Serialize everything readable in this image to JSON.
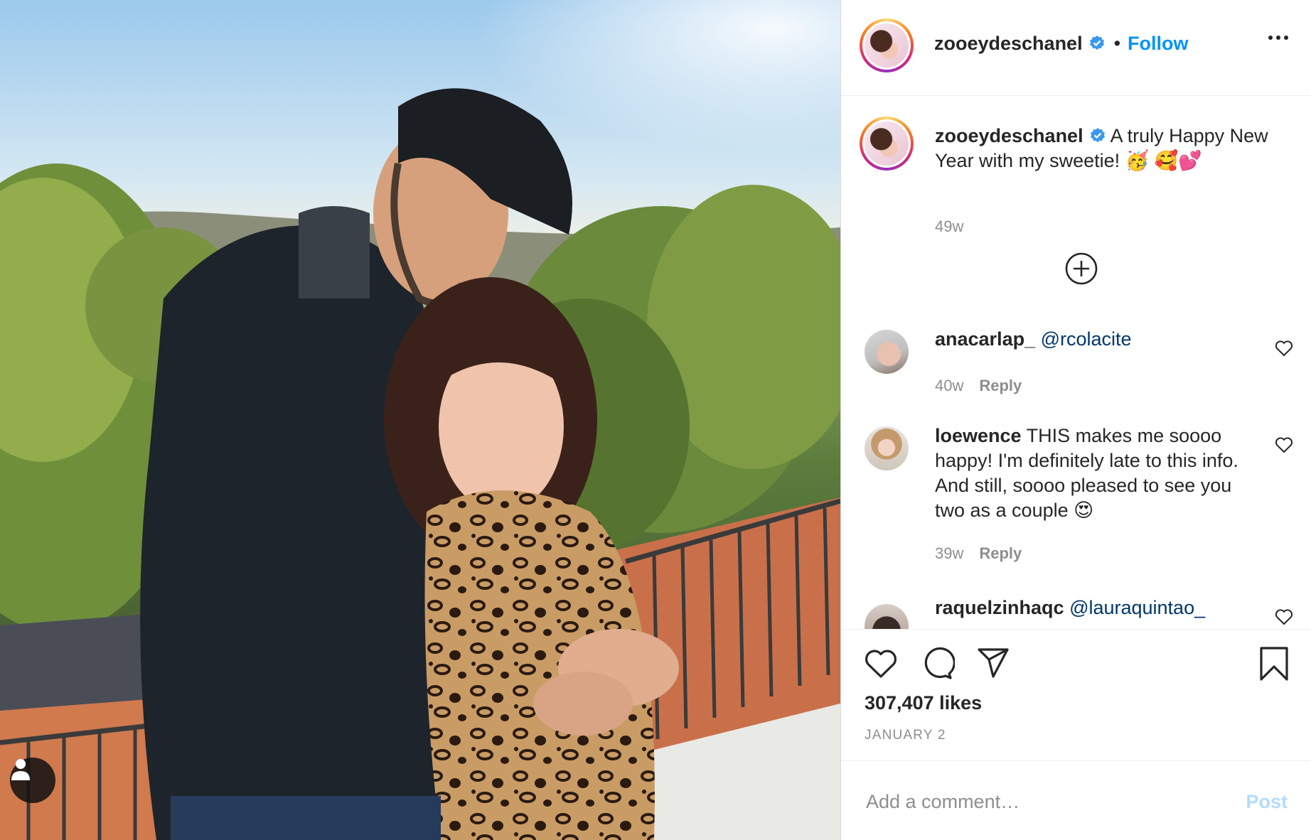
{
  "post": {
    "username": "zooeydeschanel",
    "follow_label": "Follow",
    "caption": "A truly Happy New Year with my sweetie! 🥳 🥰💕",
    "caption_age": "49w",
    "likes": "307,407 likes",
    "date": "JANUARY 2"
  },
  "comments": [
    {
      "username": "anacarlap_",
      "text": "@rcolacite",
      "age": "40w",
      "reply_label": "Reply"
    },
    {
      "username": "loewence",
      "text": "THIS makes me soooo happy! I'm definitely late to this info. And still, soooo pleased to see you two as a couple 😍",
      "age": "39w",
      "reply_label": "Reply"
    },
    {
      "username": "raquelzinhaqc",
      "text": "@lauraquintao_"
    }
  ],
  "add_comment": {
    "placeholder": "Add a comment…",
    "post_label": "Post"
  },
  "colors": {
    "link_blue": "#0095f6",
    "post_disabled": "#b3dbff",
    "muted": "#8e8e8e"
  },
  "icons": [
    "verified-badge-icon",
    "more-options-icon",
    "load-more-plus-icon",
    "heart-icon",
    "comment-icon",
    "share-icon",
    "save-bookmark-icon",
    "tagged-user-icon"
  ]
}
